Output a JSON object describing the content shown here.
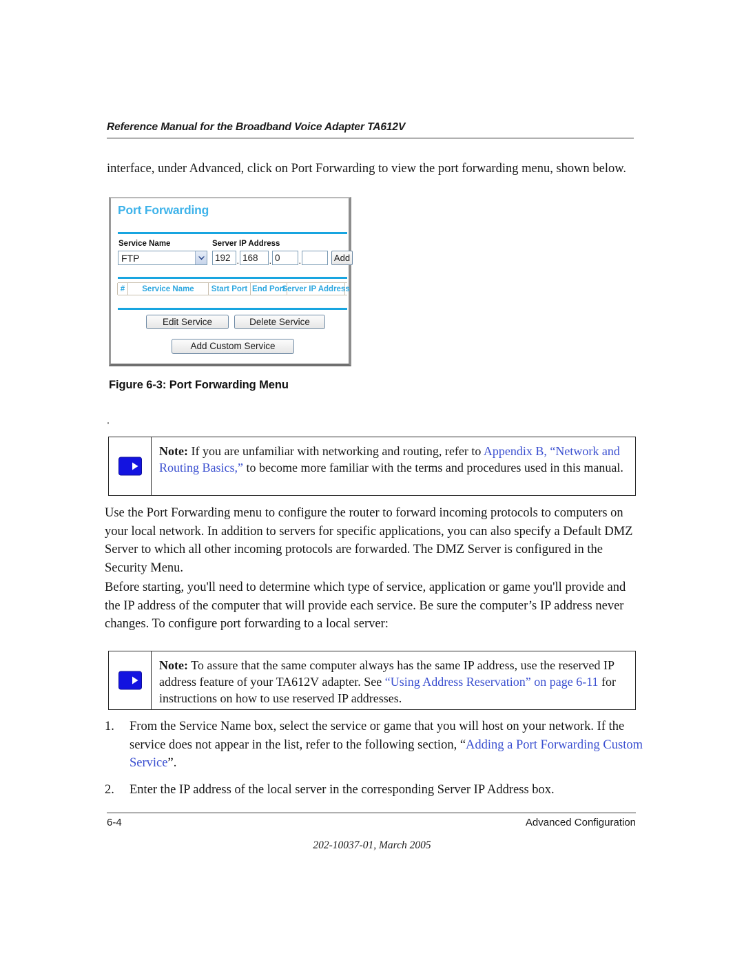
{
  "header": {
    "running_title": "Reference Manual for the Broadband Voice Adapter TA612V"
  },
  "intro_paragraph": "interface, under Advanced, click on Port Forwarding to view the port forwarding menu, shown below.",
  "figure": {
    "caption": "Figure 6-3:  Port Forwarding Menu",
    "colors": {
      "title_blue": "#3fb3ea",
      "rule_blue": "#18a5e0",
      "table_header_blue": "#2ea8e0",
      "field_border": "#7b9bb5"
    },
    "screen": {
      "title": "Port Forwarding",
      "labels": {
        "service_name": "Service Name",
        "server_ip_address": "Server IP Address"
      },
      "service_select": {
        "value": "FTP",
        "icon": "chevron-down-icon"
      },
      "ip_octets": [
        "192",
        "168",
        "0",
        ""
      ],
      "ip_separator": ".",
      "add_button": "Add",
      "table_headers": [
        "#",
        "Service Name",
        "Start Port",
        "End Port",
        "Server IP Address"
      ],
      "table_rows": [],
      "buttons": {
        "edit_service": "Edit Service",
        "delete_service": "Delete Service",
        "add_custom_service": "Add Custom Service"
      }
    }
  },
  "notes": [
    {
      "icon": "blue-arrow-note-icon",
      "label": "Note:",
      "segments": [
        {
          "text": " If you are unfamiliar with networking and routing, refer to ",
          "link": false
        },
        {
          "text": "Appendix B, “Network and Routing Basics,”",
          "link": true
        },
        {
          "text": " to become more familiar with the terms and procedures used in this manual.",
          "link": false
        }
      ]
    },
    {
      "icon": "blue-arrow-note-icon",
      "label": "Note:",
      "segments": [
        {
          "text": " To assure that the same computer always has the same IP address, use the reserved IP address feature of your TA612V adapter. See ",
          "link": false
        },
        {
          "text": "“Using Address Reservation” on page 6-11",
          "link": true
        },
        {
          "text": " for instructions on how to use reserved IP addresses.",
          "link": false
        }
      ]
    }
  ],
  "body": {
    "paragraph_use": "Use the Port Forwarding menu to configure the router to forward incoming protocols to computers on your local network. In addition to servers for specific applications, you can also specify a Default DMZ Server to which all other incoming protocols are forwarded. The DMZ Server is configured in the Security Menu.",
    "paragraph_before": "Before starting, you'll need to determine which type of service, application or game you'll provide and the IP address of the computer that will provide each service. Be sure the computer’s IP address never changes. To configure port forwarding to a local server:"
  },
  "steps": [
    {
      "number": "1.",
      "segments": [
        {
          "text": "From the Service Name box, select the service or game that you will host on your network. If the service does not appear in the list, refer to the following section, “",
          "link": false
        },
        {
          "text": "Adding a Port Forwarding Custom Service",
          "link": true
        },
        {
          "text": "”.",
          "link": false
        }
      ]
    },
    {
      "number": "2.",
      "segments": [
        {
          "text": "Enter the IP address of the local server in the corresponding Server IP Address box.",
          "link": false
        }
      ]
    }
  ],
  "footer": {
    "page_number": "6-4",
    "section": "Advanced Configuration",
    "doc_id": "202-10037-01, March 2005"
  }
}
